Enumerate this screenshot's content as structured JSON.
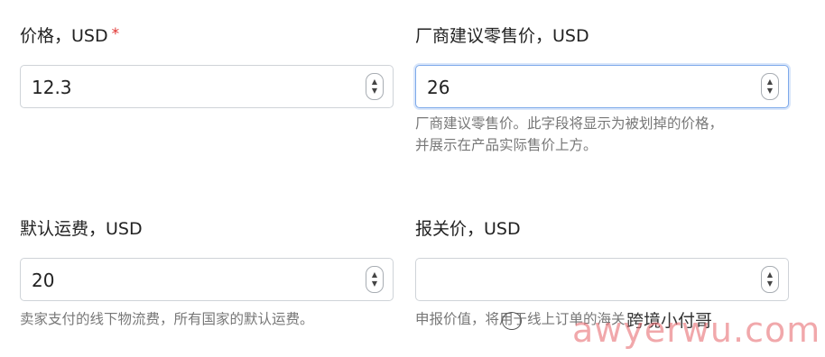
{
  "fields": {
    "price": {
      "label": "价格，USD",
      "required_mark": "*",
      "value": "12.3"
    },
    "msrp": {
      "label": "厂商建议零售价，USD",
      "value": "26",
      "help_line1": "厂商建议零售价。此字段将显示为被划掉的价格，",
      "help_line2": "并展示在产品实际售价上方。"
    },
    "shipping": {
      "label": "默认运费，USD",
      "value": "20",
      "help": "卖家支付的线下物流费，所有国家的默认运费。"
    },
    "customs": {
      "label": "报关价，USD",
      "value": "",
      "help": "申报价值，将用于线上订单的海关"
    }
  },
  "stepper": {
    "up": "▲",
    "down": "▼"
  },
  "watermark": {
    "small": "跨境小付哥",
    "big": "awyerwu.com"
  }
}
